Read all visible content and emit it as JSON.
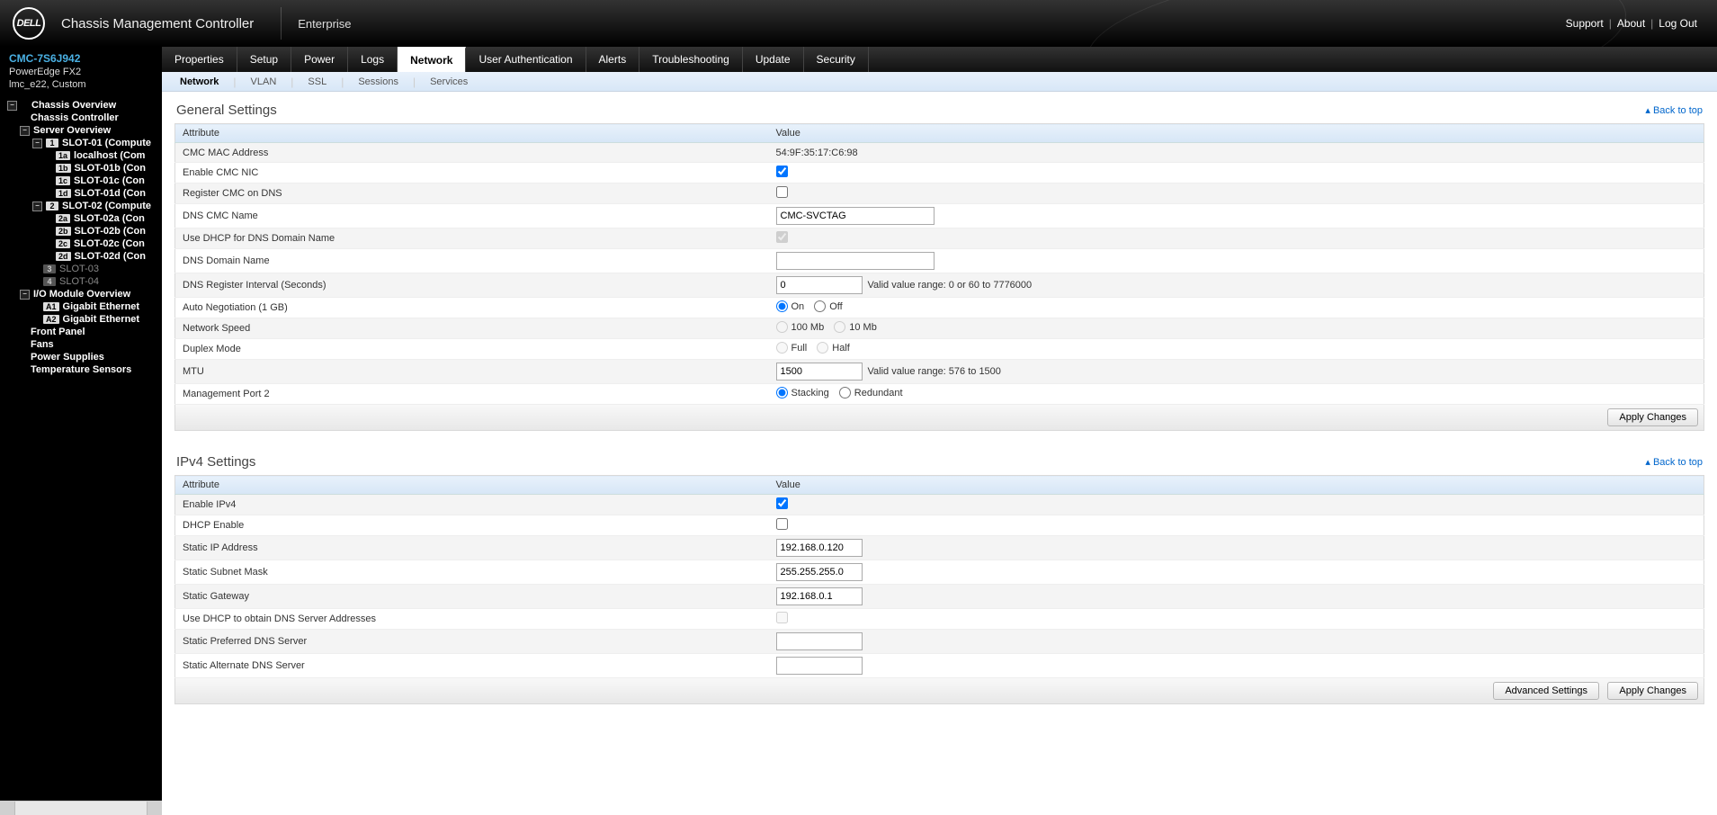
{
  "banner": {
    "logo_text": "DELL",
    "title": "Chassis Management Controller",
    "subtitle": "Enterprise",
    "links": {
      "support": "Support",
      "about": "About",
      "logout": "Log Out"
    }
  },
  "sidebar": {
    "service_tag": "CMC-7S6J942",
    "model": "PowerEdge FX2",
    "location": "lmc_e22, Custom",
    "nodes": {
      "chassis_overview": "Chassis Overview",
      "chassis_controller": "Chassis Controller",
      "server_overview": "Server Overview",
      "slot01": "SLOT-01 (Compute",
      "slot01a": "localhost (Com",
      "slot01b": "SLOT-01b (Con",
      "slot01c": "SLOT-01c (Con",
      "slot01d": "SLOT-01d (Con",
      "slot02": "SLOT-02 (Compute",
      "slot02a": "SLOT-02a (Con",
      "slot02b": "SLOT-02b (Con",
      "slot02c": "SLOT-02c (Con",
      "slot02d": "SLOT-02d (Con",
      "slot03": "SLOT-03",
      "slot04": "SLOT-04",
      "io_overview": "I/O Module Overview",
      "gige1": "Gigabit Ethernet",
      "gige2": "Gigabit Ethernet",
      "front_panel": "Front Panel",
      "fans": "Fans",
      "power_supplies": "Power Supplies",
      "temp_sensors": "Temperature Sensors"
    }
  },
  "tabs1": [
    "Properties",
    "Setup",
    "Power",
    "Logs",
    "Network",
    "User Authentication",
    "Alerts",
    "Troubleshooting",
    "Update",
    "Security"
  ],
  "tabs1_active": 4,
  "tabs2": [
    "Network",
    "VLAN",
    "SSL",
    "Sessions",
    "Services"
  ],
  "tabs2_active": 0,
  "back_to_top": "Back to top",
  "general": {
    "title": "General Settings",
    "col_attr": "Attribute",
    "col_val": "Value",
    "rows": {
      "mac_label": "CMC MAC Address",
      "mac_value": "54:9F:35:17:C6:98",
      "enable_nic": "Enable CMC NIC",
      "register_dns": "Register CMC on DNS",
      "dns_name_label": "DNS CMC Name",
      "dns_name_value": "CMC-SVCTAG",
      "dhcp_dns_domain": "Use DHCP for DNS Domain Name",
      "dns_domain_label": "DNS Domain Name",
      "dns_domain_value": "",
      "dns_interval_label": "DNS Register Interval (Seconds)",
      "dns_interval_value": "0",
      "dns_interval_hint": "Valid value range: 0 or 60 to 7776000",
      "autoneg_label": "Auto Negotiation (1 GB)",
      "on": "On",
      "off": "Off",
      "speed_label": "Network Speed",
      "speed_100": "100 Mb",
      "speed_10": "10 Mb",
      "duplex_label": "Duplex Mode",
      "full": "Full",
      "half": "Half",
      "mtu_label": "MTU",
      "mtu_value": "1500",
      "mtu_hint": "Valid value range: 576 to 1500",
      "mgmt2_label": "Management Port 2",
      "stacking": "Stacking",
      "redundant": "Redundant"
    },
    "apply": "Apply Changes"
  },
  "ipv4": {
    "title": "IPv4 Settings",
    "col_attr": "Attribute",
    "col_val": "Value",
    "rows": {
      "enable": "Enable IPv4",
      "dhcp": "DHCP Enable",
      "ip_label": "Static IP Address",
      "ip_value": "192.168.0.120",
      "mask_label": "Static Subnet Mask",
      "mask_value": "255.255.255.0",
      "gw_label": "Static Gateway",
      "gw_value": "192.168.0.1",
      "dhcp_dns": "Use DHCP to obtain DNS Server Addresses",
      "dns1_label": "Static Preferred DNS Server",
      "dns1_value": "",
      "dns2_label": "Static Alternate DNS Server",
      "dns2_value": ""
    },
    "advanced": "Advanced Settings",
    "apply": "Apply Changes"
  }
}
